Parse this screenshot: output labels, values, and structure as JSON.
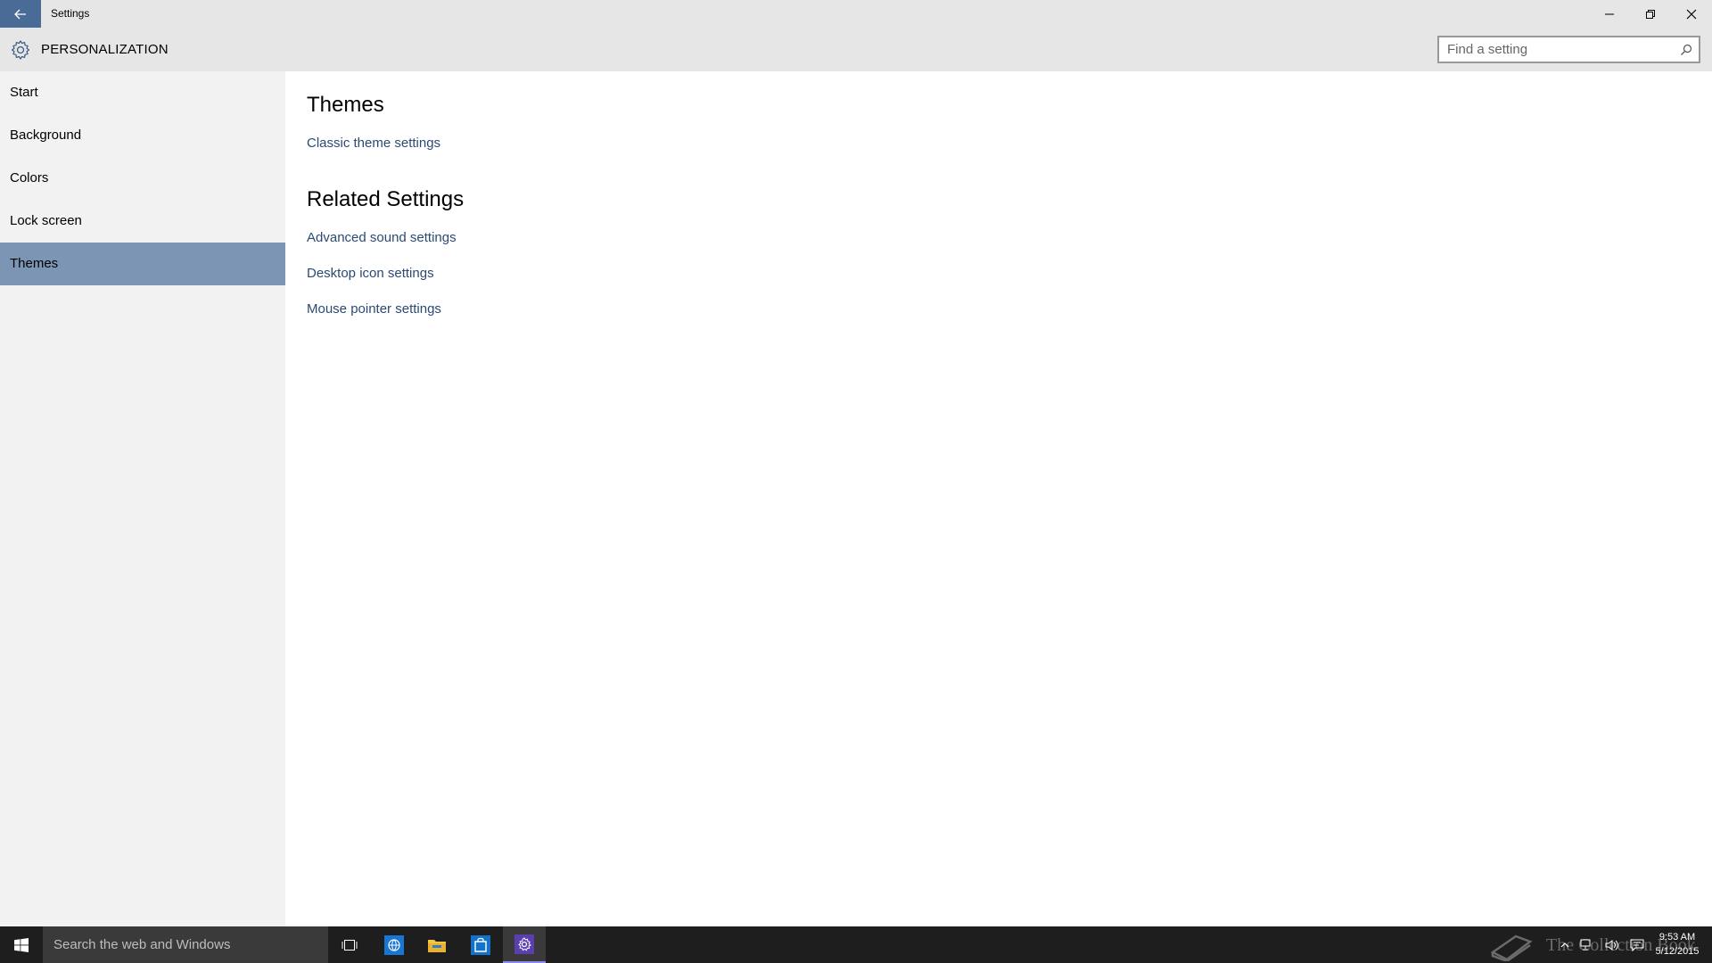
{
  "window": {
    "title": "Settings"
  },
  "header": {
    "title": "PERSONALIZATION",
    "search_placeholder": "Find a setting"
  },
  "sidebar": {
    "items": [
      {
        "label": "Start"
      },
      {
        "label": "Background"
      },
      {
        "label": "Colors"
      },
      {
        "label": "Lock screen"
      },
      {
        "label": "Themes",
        "selected": true
      }
    ]
  },
  "main": {
    "themes_title": "Themes",
    "themes_link": "Classic theme settings",
    "related_title": "Related Settings",
    "related_links": [
      {
        "label": "Advanced sound settings"
      },
      {
        "label": "Desktop icon settings"
      },
      {
        "label": "Mouse pointer settings"
      }
    ]
  },
  "taskbar": {
    "search_placeholder": "Search the web and Windows",
    "watermark": "The Collection Book",
    "time": "9:53 AM",
    "date": "5/12/2015"
  },
  "colors": {
    "accent": "#4a6b96",
    "selected_nav": "#7d95b4",
    "link": "#2a4a74",
    "header_bg": "#e6e6e6",
    "sidebar_bg": "#f2f2f2",
    "taskbar_bg": "#1e1e1e"
  }
}
